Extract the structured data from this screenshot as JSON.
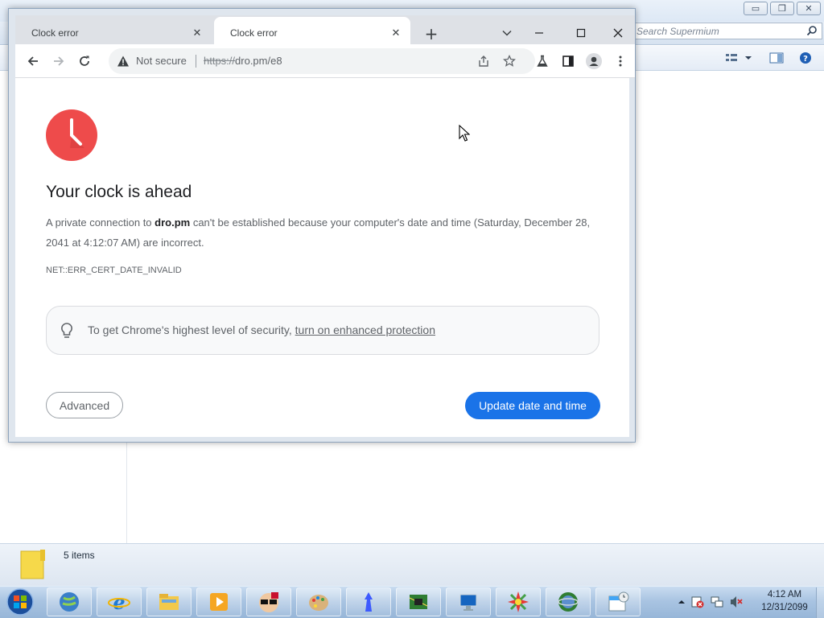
{
  "explorer": {
    "search_placeholder": "Search Supermium",
    "status_count": "5 items"
  },
  "browser": {
    "tabs": [
      {
        "label": "Clock error",
        "active": false
      },
      {
        "label": "Clock error",
        "active": true
      }
    ],
    "omnibox": {
      "security_label": "Not secure",
      "url_scheme": "https://",
      "url_rest": "dro.pm/e8"
    }
  },
  "error_page": {
    "heading": "Your clock is ahead",
    "para_prefix": "A private connection to ",
    "host": "dro.pm",
    "para_suffix": " can't be established because your computer's date and time (Saturday, December 28, 2041 at 4:12:07 AM) are incorrect.",
    "error_code": "NET::ERR_CERT_DATE_INVALID",
    "tip_text": "To get Chrome's highest level of security, ",
    "tip_link": "turn on enhanced protection",
    "advanced_button": "Advanced",
    "update_button": "Update date and time",
    "accent_color": "#1a73e8",
    "icon_color": "#ee4b4b"
  },
  "taskbar": {
    "apps": [
      "globe-icon",
      "internet-explorer-icon",
      "file-explorer-icon",
      "media-player-icon",
      "cartoon-face-icon",
      "paint-palette-icon",
      "blue-figure-icon",
      "circuit-board-icon",
      "monitor-icon",
      "colorful-burst-icon",
      "green-globe-icon",
      "calendar-clock-icon"
    ],
    "time": "4:12 AM",
    "date": "12/31/2099"
  }
}
